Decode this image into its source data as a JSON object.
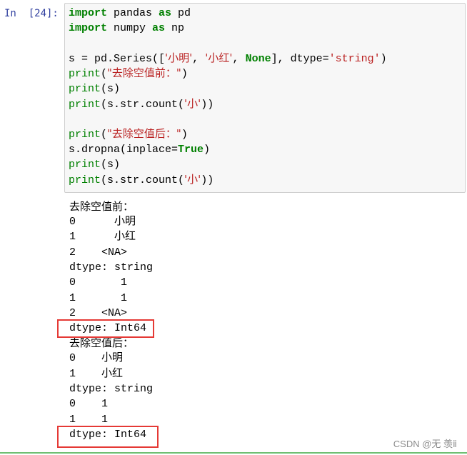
{
  "cell": {
    "prompt": "In  [24]:"
  },
  "code": {
    "l1_kw1": "import",
    "l1_rest": " pandas ",
    "l1_kw2": "as",
    "l1_end": " pd",
    "l2_kw1": "import",
    "l2_rest": " numpy ",
    "l2_kw2": "as",
    "l2_end": " np",
    "l3_pre": "s = pd.Series([",
    "l3_s1": "'小明'",
    "l3_c1": ", ",
    "l3_s2": "'小红'",
    "l3_c2": ", ",
    "l3_none": "None",
    "l3_mid": "], dtype=",
    "l3_s3": "'string'",
    "l3_end": ")",
    "l4_fn": "print",
    "l4_open": "(",
    "l4_str": "\"去除空值前：\"",
    "l4_close": ")",
    "l5_fn": "print",
    "l5_rest": "(s)",
    "l6_fn": "print",
    "l6_pre": "(s.str.count(",
    "l6_str": "'小'",
    "l6_end": "))",
    "l7_fn": "print",
    "l7_open": "(",
    "l7_str": "\"去除空值后：\"",
    "l7_close": ")",
    "l8_pre": "s.dropna(inplace=",
    "l8_kw": "True",
    "l8_end": ")",
    "l9_fn": "print",
    "l9_rest": "(s)",
    "l10_fn": "print",
    "l10_pre": "(s.str.count(",
    "l10_str": "'小'",
    "l10_end": "))"
  },
  "output": {
    "lines": [
      "去除空值前：",
      "0      小明",
      "1      小红",
      "2    <NA>",
      "dtype: string",
      "0       1",
      "1       1",
      "2    <NA>",
      "dtype: Int64",
      "去除空值后：",
      "0    小明",
      "1    小红",
      "dtype: string",
      "0    1",
      "1    1",
      "dtype: Int64"
    ]
  },
  "watermark": "CSDN @无 羡ⅱ",
  "colors": {
    "keyword": "#008000",
    "string": "#ba2121",
    "prompt": "#303f9f",
    "highlight_box": "#e53935",
    "input_bg": "#f7f7f7"
  }
}
